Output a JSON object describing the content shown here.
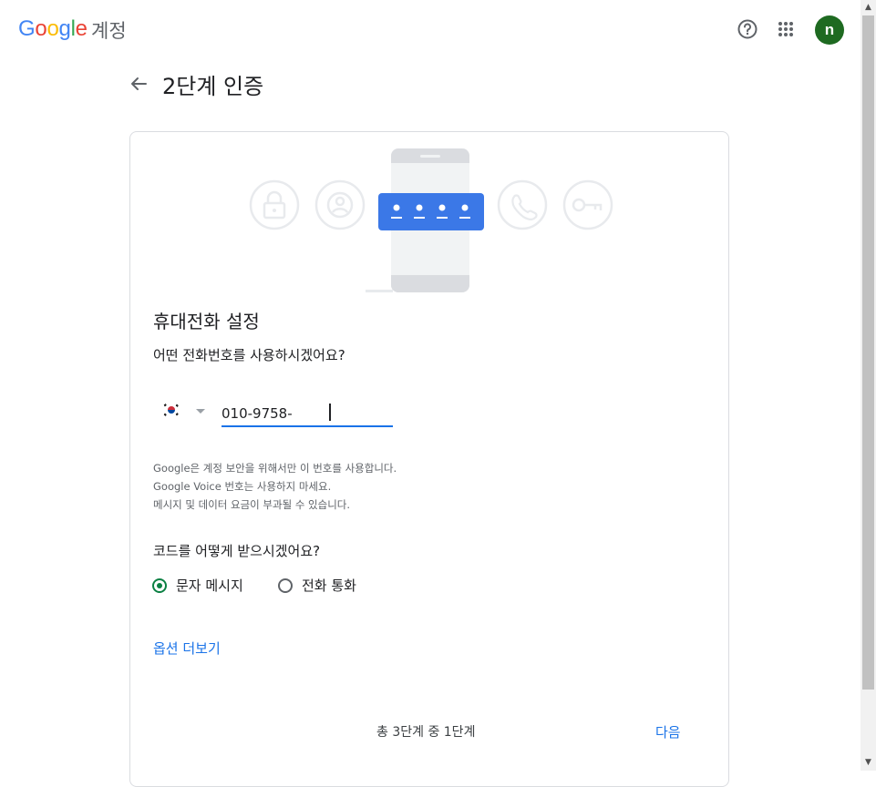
{
  "header": {
    "logo_text": "Google",
    "product": "계정",
    "help_icon": "help-circle-icon",
    "apps_icon": "apps-grid-icon",
    "avatar_letter": "n",
    "avatar_color": "#1e6a21"
  },
  "page": {
    "back_icon": "arrow-back-icon",
    "title": "2단계 인증"
  },
  "card": {
    "illustration_icons": [
      "lock-icon",
      "account-icon",
      "phone-code-icon",
      "phone-call-icon",
      "key-icon"
    ],
    "section_title": "휴대전화 설정",
    "question": "어떤 전화번호를 사용하시겠어요?",
    "country_flag": "korea-flag-icon",
    "phone_value": "010-9758-",
    "notice_lines": [
      "Google은 계정 보안을 위해서만 이 번호를 사용합니다.",
      "Google Voice 번호는 사용하지 마세요.",
      "메시지 및 데이터 요금이 부과될 수 있습니다."
    ],
    "code_question": "코드를 어떻게 받으시겠어요?",
    "options": [
      {
        "label": "문자 메시지",
        "selected": true
      },
      {
        "label": "전화 통화",
        "selected": false
      }
    ],
    "more_options": "옵션 더보기",
    "step_text": "총 3단계 중 1단계",
    "next_label": "다음"
  },
  "colors": {
    "accent": "#1a73e8",
    "radio_selected": "#0b8043"
  }
}
